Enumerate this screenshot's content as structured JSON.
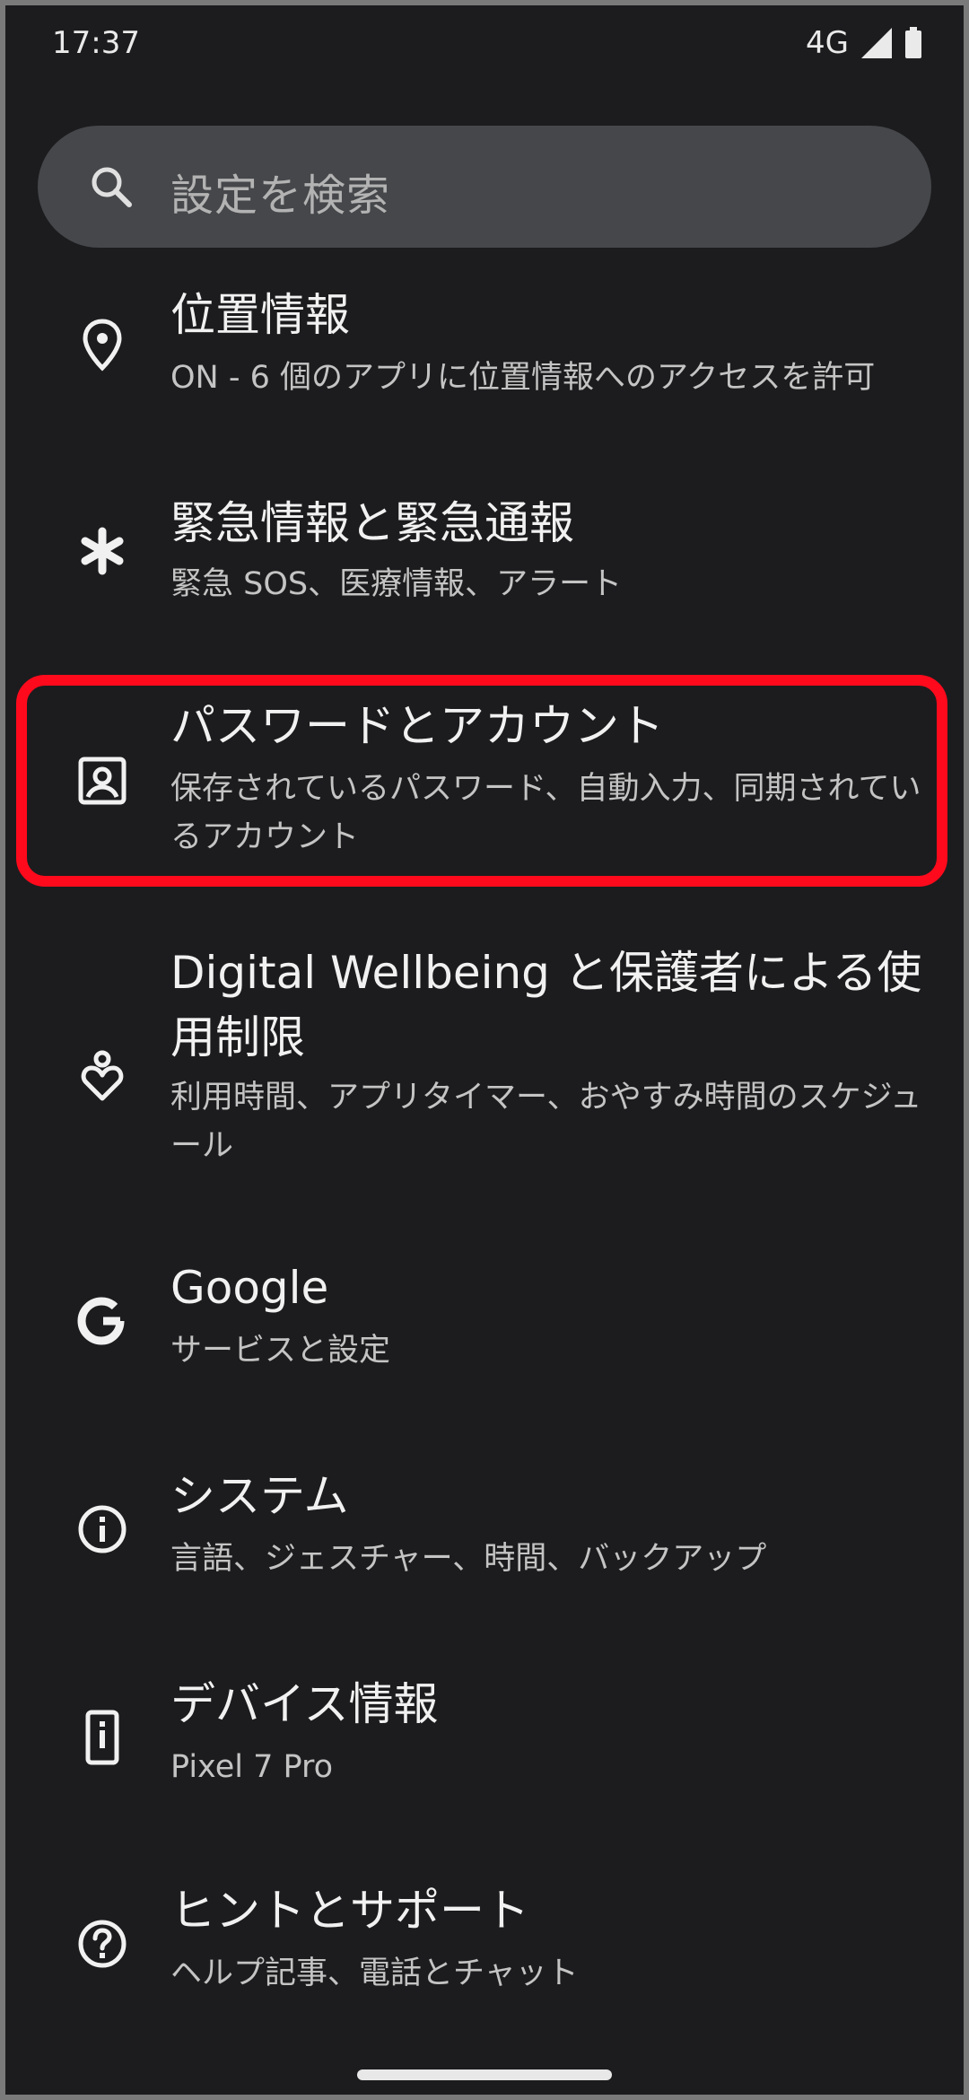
{
  "status_bar": {
    "time": "17:37",
    "network": "4G"
  },
  "search": {
    "placeholder": "設定を検索"
  },
  "items": [
    {
      "title": "位置情報",
      "subtitle": "ON - 6 個のアプリに位置情報へのアクセスを許可",
      "icon": "location-icon"
    },
    {
      "title": "緊急情報と緊急通報",
      "subtitle": "緊急 SOS、医療情報、アラート",
      "icon": "asterisk-icon"
    },
    {
      "title": "パスワードとアカウント",
      "subtitle": "保存されているパスワード、自動入力、同期されているアカウント",
      "icon": "account-box-icon",
      "highlighted": true
    },
    {
      "title": "Digital Wellbeing と保護者による使用制限",
      "subtitle": "利用時間、アプリタイマー、おやすみ時間のスケジュール",
      "icon": "wellbeing-icon"
    },
    {
      "title": "Google",
      "subtitle": "サービスと設定",
      "icon": "google-g-icon"
    },
    {
      "title": "システム",
      "subtitle": "言語、ジェスチャー、時間、バックアップ",
      "icon": "info-icon"
    },
    {
      "title": "デバイス情報",
      "subtitle": "Pixel 7 Pro",
      "icon": "device-info-icon"
    },
    {
      "title": "ヒントとサポート",
      "subtitle": "ヘルプ記事、電話とチャット",
      "icon": "help-icon"
    }
  ],
  "colors": {
    "background": "#1c1c1e",
    "highlight": "#ff0a1c",
    "search_bg": "#45474a"
  }
}
